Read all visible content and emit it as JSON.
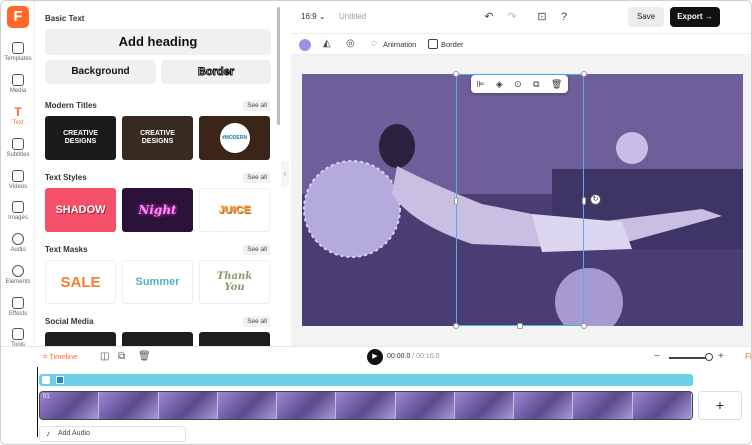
{
  "app": {
    "logo_letter": "F",
    "brand_color": "#ff6a2b"
  },
  "rail": {
    "items": [
      {
        "label": "Templates",
        "icon": "templates-icon"
      },
      {
        "label": "Media",
        "icon": "media-icon"
      },
      {
        "label": "Text",
        "icon": "text-icon",
        "active": true
      },
      {
        "label": "Subtitles",
        "icon": "subtitles-icon"
      },
      {
        "label": "Videos",
        "icon": "videos-icon"
      },
      {
        "label": "Images",
        "icon": "images-icon"
      },
      {
        "label": "Audio",
        "icon": "audio-icon"
      },
      {
        "label": "Elements",
        "icon": "elements-icon"
      },
      {
        "label": "Effects",
        "icon": "effects-icon"
      },
      {
        "label": "Tools",
        "icon": "tools-icon"
      }
    ]
  },
  "panel": {
    "basic_text": {
      "title": "Basic Text",
      "add_heading": "Add heading",
      "background": "Background",
      "border": "Border"
    },
    "modern_titles": {
      "title": "Modern Titles",
      "see_all": "See all",
      "items": [
        "CREATIVE DESIGNS",
        "CREATIVE DESIGNS",
        "#MODERN"
      ]
    },
    "text_styles": {
      "title": "Text Styles",
      "see_all": "See all",
      "items": [
        "SHADOW",
        "Night",
        "JUICE"
      ]
    },
    "text_masks": {
      "title": "Text Masks",
      "see_all": "See all",
      "items": [
        "SALE",
        "Summer",
        "Thank You"
      ]
    },
    "social_media": {
      "title": "Social Media",
      "see_all": "See all"
    }
  },
  "topbar": {
    "ratio": "16:9",
    "project_name": "Untitled",
    "save": "Save",
    "export": "Export"
  },
  "toolbar": {
    "animation": "Animation",
    "border": "Border",
    "color": "#a38ee6"
  },
  "timeline": {
    "tab": "Timeline",
    "current_time": "00:00.0",
    "separator": " / ",
    "total_time": "00:16.0",
    "video_label": "01",
    "add_audio": "Add Audio",
    "add_clip": "+",
    "cut_text": "Fi"
  }
}
